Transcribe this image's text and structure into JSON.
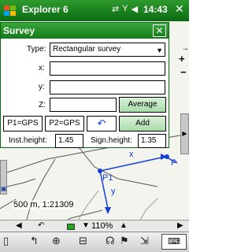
{
  "titlebar": {
    "app_title": "Explorer 6",
    "clock": "14:43",
    "close_label": "✕",
    "status_icons": [
      "⇄",
      "Y",
      "◀"
    ]
  },
  "dialog": {
    "title": "Survey",
    "close_label": "✕",
    "type_label": "Type:",
    "type_value": "Rectangular survey",
    "x_label": "x:",
    "y_label": "y:",
    "z_label": "Z:",
    "average_label": "Average",
    "p1_label": "P1=GPS",
    "p2_label": "P2=GPS",
    "undo_label": "↶",
    "add_label": "Add",
    "inst_height_label": "Inst.height:",
    "inst_height_value": "1.45",
    "sign_height_label": "Sign.height:",
    "sign_height_value": "1.35"
  },
  "map": {
    "scale_text": "500 m, 1:21309",
    "point_label_p1": "P1",
    "point_label_p": "P",
    "axis_x_label": "x",
    "axis_y_label": "y",
    "zoom_level": "110%"
  },
  "toolbar": {
    "items": [
      "▯",
      "↰",
      "⊕",
      "⊟",
      "☊",
      "⚑",
      "⇲"
    ],
    "keyboard_label": "⌨"
  },
  "colors": {
    "titlebar": "#0b6a12",
    "survey_lines": "#1540d6"
  }
}
